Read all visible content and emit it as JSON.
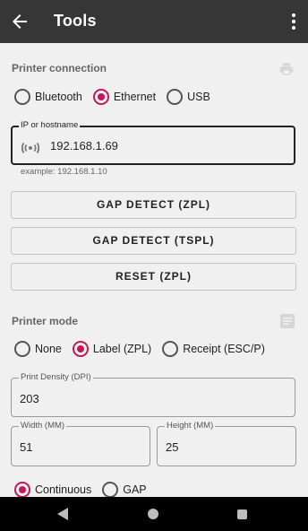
{
  "appbar": {
    "title": "Tools",
    "back_icon": "arrow-back-icon",
    "menu_icon": "more-vert-icon"
  },
  "printer_connection": {
    "title": "Printer connection",
    "icon": "printer-icon",
    "options": [
      {
        "label": "Bluetooth",
        "checked": false
      },
      {
        "label": "Ethernet",
        "checked": true
      },
      {
        "label": "USB",
        "checked": false
      }
    ],
    "ip_field": {
      "label": "IP or hostname",
      "value": "192.168.1.69",
      "icon": "wifi-signal-icon",
      "helper": "example: 192.168.1.10"
    }
  },
  "buttons": {
    "gap_detect_zpl": "GAP DETECT (ZPL)",
    "gap_detect_tspl": "GAP DETECT (TSPL)",
    "reset_zpl": "RESET (ZPL)"
  },
  "printer_mode": {
    "title": "Printer mode",
    "icon": "notes-icon",
    "options": [
      {
        "label": "None",
        "checked": false
      },
      {
        "label": "Label (ZPL)",
        "checked": true
      },
      {
        "label": "Receipt (ESC/P)",
        "checked": false
      }
    ],
    "print_density": {
      "label": "Print Density (DPI)",
      "value": "203"
    },
    "width": {
      "label": "Width (MM)",
      "value": "51"
    },
    "height": {
      "label": "Height (MM)",
      "value": "25"
    },
    "media_options": [
      {
        "label": "Continuous",
        "checked": true
      },
      {
        "label": "GAP",
        "checked": false
      }
    ]
  },
  "colors": {
    "accent": "#c2185b",
    "appbar": "#363636",
    "background": "#f0f0f0"
  }
}
